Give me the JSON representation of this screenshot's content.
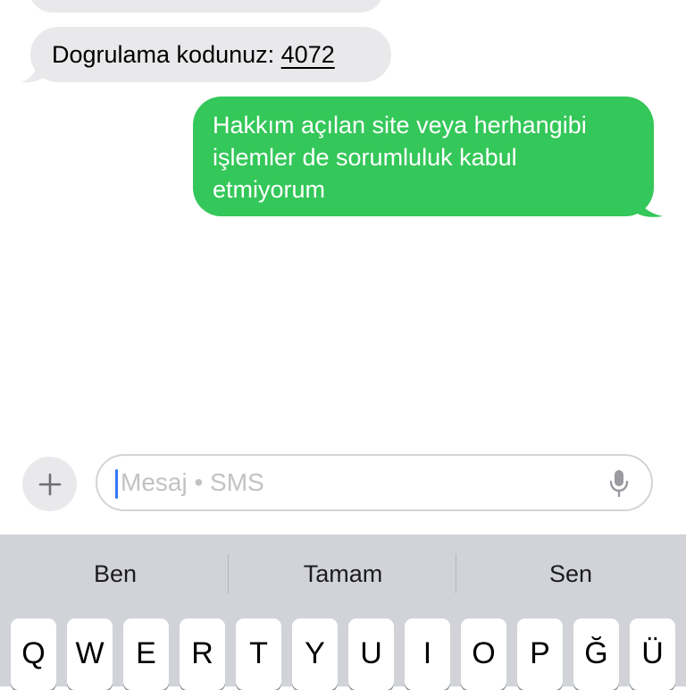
{
  "conversation": {
    "incoming_code_prefix": "Dogrulama kodunuz: ",
    "incoming_code_value": "4072",
    "outgoing_lines": [
      "Hakkım açılan site veya herhangibi",
      "işlemler de sorumluluk kabul",
      "etmiyorum"
    ]
  },
  "compose": {
    "add_icon": "plus-icon",
    "placeholder": "Mesaj • SMS",
    "mic_icon": "microphone-icon"
  },
  "keyboard": {
    "suggestions": [
      "Ben",
      "Tamam",
      "Sen"
    ],
    "top_row": [
      "Q",
      "W",
      "E",
      "R",
      "T",
      "Y",
      "U",
      "I",
      "O",
      "P",
      "Ğ",
      "Ü"
    ]
  },
  "colors": {
    "outgoing_bubble": "#34c759",
    "incoming_bubble": "#e9e9eb",
    "caret": "#3478f6",
    "keyboard_bg": "#d1d3d9"
  }
}
